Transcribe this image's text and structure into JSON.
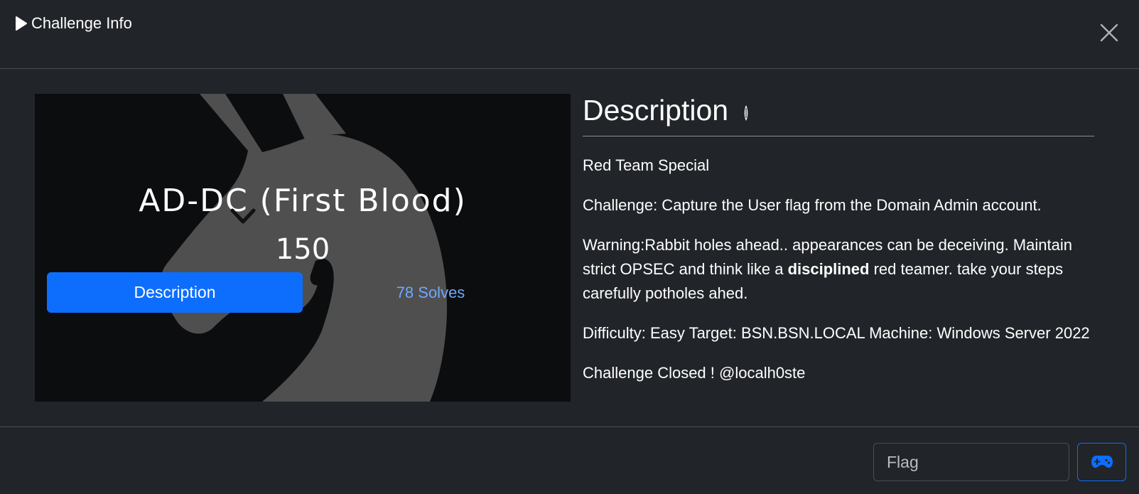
{
  "header": {
    "title": "Challenge Info",
    "icon": "play-icon",
    "close_icon": "close-icon"
  },
  "challenge": {
    "name": "AD-DC (First Blood)",
    "points": "150",
    "description_button": "Description",
    "solves": "78 Solves"
  },
  "description": {
    "heading": "Description",
    "heading_icon": "pen-icon",
    "line1": "Red Team Special",
    "line2": "Challenge: Capture the User flag from the Domain Admin account.",
    "line3_pre": "Warning:Rabbit holes ahead.. appearances can be deceiving. Maintain strict OPSEC and think like a ",
    "line3_bold": "disciplined",
    "line3_post": " red teamer. take your steps carefully potholes ahed.",
    "line4": "Difficulty: Easy Target: BSN.BSN.LOCAL Machine: Windows Server 2022",
    "line5": "Challenge Closed ! @localh0ste"
  },
  "footer": {
    "flag_placeholder": "Flag",
    "flag_value": "",
    "submit_icon": "gamepad-icon"
  },
  "colors": {
    "background": "#212429",
    "accent": "#0d6efd",
    "link": "#6ea8fe",
    "hero_bg": "#0c0d0f",
    "logo_gray": "#4f4f4f"
  }
}
